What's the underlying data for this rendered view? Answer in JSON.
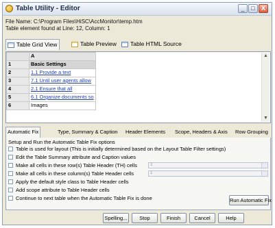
{
  "window": {
    "title": "Table Utility - Editor",
    "controls": [
      "_",
      "□",
      "X"
    ]
  },
  "info": {
    "file_line": "File Name: C:\\Program Files\\HiSC\\AccMonitor\\temp.htm",
    "element_line": "Table element found at Line: 12, Column: 1"
  },
  "view_tabs": [
    {
      "label": "Table Grid View",
      "selected": true,
      "icon": "grid-icon"
    },
    {
      "label": "Table Preview",
      "selected": false,
      "icon": "preview-icon"
    },
    {
      "label": "Table HTML Source",
      "selected": false,
      "icon": "source-icon"
    }
  ],
  "grid": {
    "column_header": "A",
    "rows": [
      {
        "num": "1",
        "text": "Basic Settings",
        "link": false,
        "highlight": true
      },
      {
        "num": "2",
        "text": "1.1 Provide a text",
        "link": true
      },
      {
        "num": "3",
        "text": "7.1 Until user agents allow",
        "link": true
      },
      {
        "num": "4",
        "text": "2.1 Ensure that all",
        "link": true
      },
      {
        "num": "5",
        "text": "6.1 Organize documents so",
        "link": true
      },
      {
        "num": "6",
        "text": "Images",
        "link": false
      }
    ]
  },
  "fix_tabs": [
    {
      "label": "Automatic Fix",
      "selected": true
    },
    {
      "label": "Type, Summary & Caption",
      "selected": false
    },
    {
      "label": "Header Elements",
      "selected": false
    },
    {
      "label": "Scope, Headers & Axis",
      "selected": false
    },
    {
      "label": "Row Grouping",
      "selected": false
    }
  ],
  "fix_panel": {
    "heading": "Setup and Run the Automatic Table Fix options",
    "options": [
      "Table is used for layout (This is initially determined based on the Layout Table Filter settings)",
      "Edit the Table Summary attribute and Caption values",
      "Make all cells in these row(s) Table Header (TH) cells",
      "Make all cells in these column(s) Table Header cells",
      "Apply the default style class to Table Header cells",
      "Add scope attribute to Table Header cells",
      "Continue to next table when the Automatic Table Fix is done"
    ],
    "row_combo_value": "1",
    "col_combo_value": "1",
    "run_button": "Run Automatic Fix"
  },
  "footer": {
    "spelling": "Spelling...",
    "stop": "Stop",
    "finish": "Finish",
    "cancel": "Cancel",
    "help": "Help"
  }
}
